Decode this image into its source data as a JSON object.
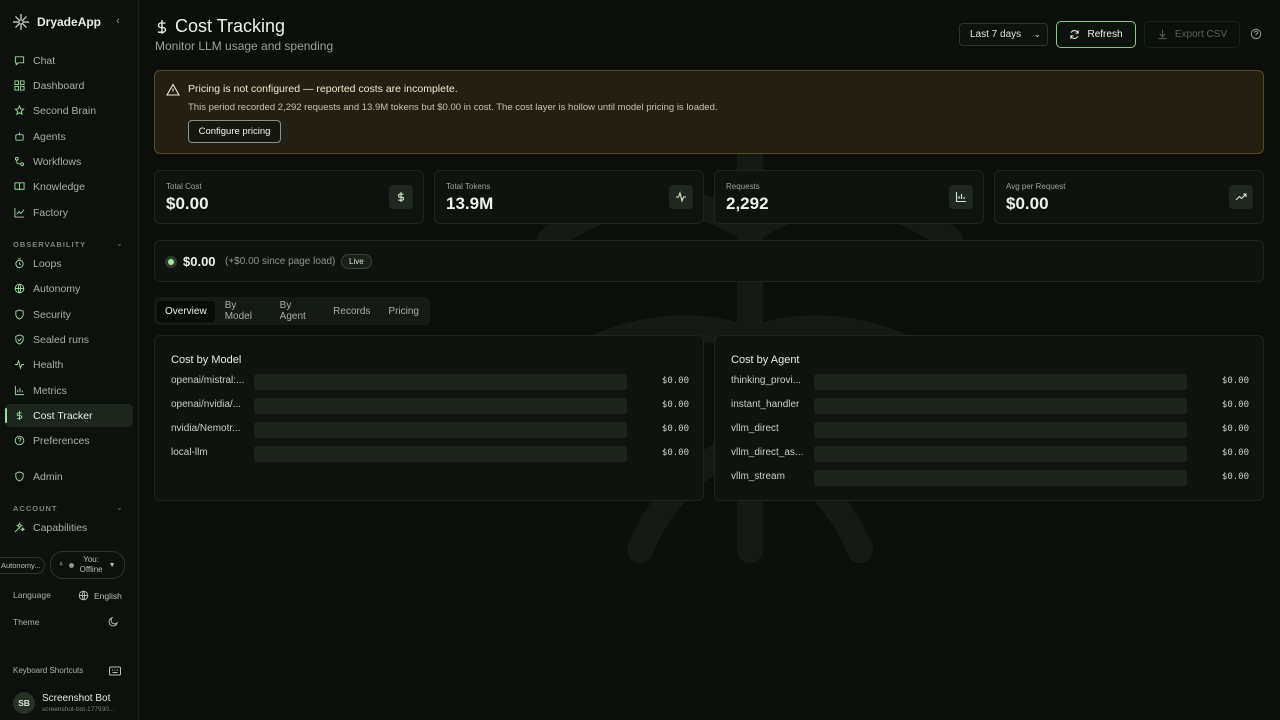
{
  "app": {
    "name": "DryadeApp"
  },
  "sidebar": {
    "main_items": [
      {
        "label": "Chat",
        "icon": "chat-icon"
      },
      {
        "label": "Dashboard",
        "icon": "dashboard-icon"
      },
      {
        "label": "Second Brain",
        "icon": "brain-icon"
      },
      {
        "label": "Agents",
        "icon": "agents-icon"
      },
      {
        "label": "Workflows",
        "icon": "workflow-icon"
      },
      {
        "label": "Knowledge",
        "icon": "book-icon"
      },
      {
        "label": "Factory",
        "icon": "factory-icon"
      }
    ],
    "observability_label": "OBSERVABILITY",
    "observability_items": [
      {
        "label": "Loops",
        "icon": "loop-icon"
      },
      {
        "label": "Autonomy",
        "icon": "globe-icon"
      },
      {
        "label": "Security",
        "icon": "shield-icon"
      },
      {
        "label": "Sealed runs",
        "icon": "shield-check-icon"
      },
      {
        "label": "Health",
        "icon": "pulse-icon"
      },
      {
        "label": "Metrics",
        "icon": "bar-chart-icon"
      },
      {
        "label": "Cost Tracker",
        "icon": "dollar-icon",
        "active": true
      },
      {
        "label": "Preferences",
        "icon": "help-circle-icon"
      }
    ],
    "admin_label": "Admin",
    "account_label": "ACCOUNT",
    "account_items": [
      {
        "label": "Capabilities",
        "icon": "sparkle-icon"
      }
    ],
    "autonomy_pill": "Autonomy...",
    "status_pill": {
      "line1": "You:",
      "line2": "Offline"
    },
    "language_label": "Language",
    "language_value": "English",
    "theme_label": "Theme",
    "shortcuts_label": "Keyboard Shortcuts",
    "user": {
      "initials": "SB",
      "name": "Screenshot Bot",
      "email": "screenshot-bot-177930..."
    }
  },
  "header": {
    "title": "Cost Tracking",
    "subtitle": "Monitor LLM usage and spending",
    "range_select": "Last 7 days",
    "refresh_label": "Refresh",
    "export_label": "Export CSV"
  },
  "alert": {
    "title": "Pricing is not configured — reported costs are incomplete.",
    "body": "This period recorded 2,292 requests and 13.9M tokens but $0.00 in cost. The cost layer is hollow until model pricing is loaded.",
    "button": "Configure pricing"
  },
  "stats": [
    {
      "label": "Total Cost",
      "value": "$0.00",
      "icon": "dollar-icon"
    },
    {
      "label": "Total Tokens",
      "value": "13.9M",
      "icon": "activity-icon"
    },
    {
      "label": "Requests",
      "value": "2,292",
      "icon": "bar-chart-icon"
    },
    {
      "label": "Avg per Request",
      "value": "$0.00",
      "icon": "trending-up-icon"
    }
  ],
  "live": {
    "amount": "$0.00",
    "delta": "(+$0.00 since page load)",
    "badge": "Live"
  },
  "tabs": [
    "Overview",
    "By Model",
    "By Agent",
    "Records",
    "Pricing"
  ],
  "active_tab": "Overview",
  "cost_by_model": {
    "title": "Cost by Model",
    "rows": [
      {
        "label": "openai/mistral:...",
        "value": "$0.00",
        "fraction": 0
      },
      {
        "label": "openai/nvidia/...",
        "value": "$0.00",
        "fraction": 0
      },
      {
        "label": "nvidia/Nemotr...",
        "value": "$0.00",
        "fraction": 0
      },
      {
        "label": "local-llm",
        "value": "$0.00",
        "fraction": 0
      }
    ]
  },
  "cost_by_agent": {
    "title": "Cost by Agent",
    "rows": [
      {
        "label": "thinking_provi...",
        "value": "$0.00",
        "fraction": 0
      },
      {
        "label": "instant_handler",
        "value": "$0.00",
        "fraction": 0
      },
      {
        "label": "vllm_direct",
        "value": "$0.00",
        "fraction": 0
      },
      {
        "label": "vllm_direct_as...",
        "value": "$0.00",
        "fraction": 0
      },
      {
        "label": "vllm_stream",
        "value": "$0.00",
        "fraction": 0
      }
    ]
  },
  "colors": {
    "accent": "#9fdc9b",
    "warning_bg": "#231f12",
    "warning_border": "#5a4a22"
  }
}
